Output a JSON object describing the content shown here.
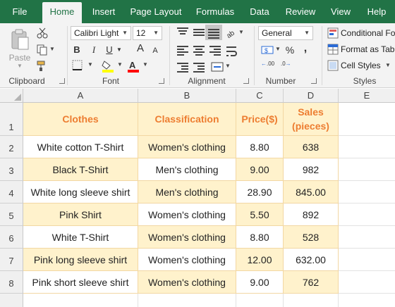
{
  "menu": {
    "tabs": [
      "File",
      "Home",
      "Insert",
      "Page Layout",
      "Formulas",
      "Data",
      "Review",
      "View",
      "Help"
    ],
    "active": "Home"
  },
  "ribbon": {
    "clipboard": {
      "paste_label": "Paste",
      "group_label": "Clipboard"
    },
    "font": {
      "font_name": "Calibri Light",
      "font_size": "12",
      "grow": "A",
      "shrink": "A",
      "bold": "B",
      "italic": "I",
      "underline": "U",
      "group_label": "Font",
      "fill_color": "#ffff00",
      "font_color": "#ff0000"
    },
    "alignment": {
      "group_label": "Alignment"
    },
    "number": {
      "format": "General",
      "currency": "$",
      "percent": "%",
      "comma": ",",
      "inc_decimal": ".00",
      "dec_decimal": ".0",
      "group_label": "Number"
    },
    "styles": {
      "conditional": "Conditional Fo",
      "format_table": "Format as Tabl",
      "cell_styles": "Cell Styles",
      "group_label": "Styles"
    }
  },
  "sheet": {
    "columns": [
      "A",
      "B",
      "C",
      "D",
      "E"
    ],
    "rows": [
      "1",
      "2",
      "3",
      "4",
      "5",
      "6",
      "7",
      "8"
    ],
    "headers": [
      "Clothes",
      "Classification",
      "Price($)",
      "Sales\n(pieces)"
    ],
    "data": [
      [
        "White cotton T-Shirt",
        "Women's clothing",
        "8.80",
        "638"
      ],
      [
        "Black T-Shirt",
        "Men's clothing",
        "9.00",
        "982"
      ],
      [
        "White long sleeve shirt",
        "Men's clothing",
        "28.90",
        "845.00"
      ],
      [
        "Pink Shirt",
        "Women's clothing",
        "5.50",
        "892"
      ],
      [
        "White T-Shirt",
        "Women's clothing",
        "8.80",
        "528"
      ],
      [
        "Pink long sleeve shirt",
        "Women's clothing",
        "12.00",
        "632.00"
      ],
      [
        "Pink short sleeve shirt",
        "Women's clothing",
        "9.00",
        "762"
      ]
    ]
  },
  "colors": {
    "brand": "#217346",
    "header_fill": "#fff2cc",
    "header_text": "#ed7d31",
    "border": "#f2d7a3"
  }
}
